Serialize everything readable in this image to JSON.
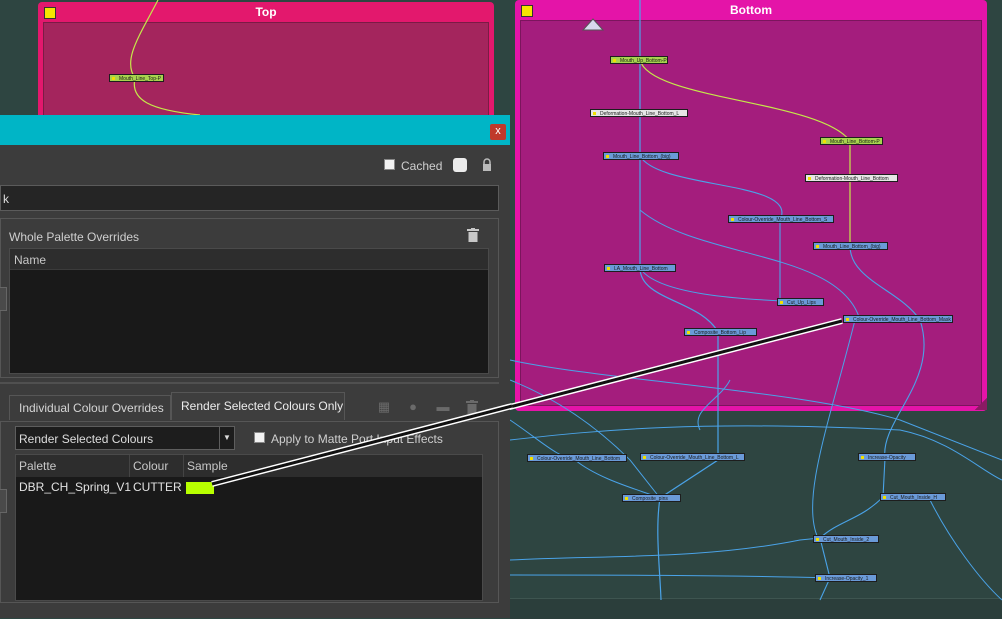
{
  "node_view": {
    "backdrops": [
      {
        "title": "Top",
        "color": "#e3186d",
        "inner": "#a4255d"
      },
      {
        "title": "Bottom",
        "color": "#e414a8",
        "inner": "#a41d7d"
      }
    ],
    "nodes": [
      {
        "label": "Mouth_Line_Top-P",
        "kind": "green"
      },
      {
        "label": "Mouth_Up_Bottom-P",
        "kind": "green"
      },
      {
        "label": "Deformation-Mouth_Line_Bottom_L",
        "kind": "white"
      },
      {
        "label": "Mouth_Line_Bottom_(big)",
        "kind": "blue"
      },
      {
        "label": "Mouth_Line_Bottom-P",
        "kind": "green"
      },
      {
        "label": "Deformation-Mouth_Line_Bottom",
        "kind": "white"
      },
      {
        "label": "Colour-Override_Mouth_Line_Bottom_S",
        "kind": "blue"
      },
      {
        "label": "Mouth_Line_Bottom_(big)",
        "kind": "blue"
      },
      {
        "label": "LA_Mouth_Line_Bottom",
        "kind": "blue"
      },
      {
        "label": "Cut_Up_Lips",
        "kind": "blue"
      },
      {
        "label": "Colour-Override_Mouth_Line_Bottom_Mask",
        "kind": "blue"
      },
      {
        "label": "Composite_Bottom_Lip",
        "kind": "blue"
      },
      {
        "label": "Colour-Override_Mouth_Line_Bottom",
        "kind": "blue"
      },
      {
        "label": "Colour-Override_Mouth_Line_Bottom_L",
        "kind": "blue"
      },
      {
        "label": "Increase-Opacity",
        "kind": "blue"
      },
      {
        "label": "Composite_pins",
        "kind": "blue"
      },
      {
        "label": "Cut_Mouth_Inside_H",
        "kind": "blue"
      },
      {
        "label": "Cut_Mouth_Inside_2",
        "kind": "blue"
      },
      {
        "label": "Increase-Opacity_1",
        "kind": "blue"
      }
    ]
  },
  "panel": {
    "close_glyph": "x",
    "cached_label": "Cached",
    "name_value": "k",
    "whole_palette_title": "Whole Palette Overrides",
    "wpo_column": "Name",
    "tabs": [
      {
        "label": "Individual Colour Overrides",
        "active": false
      },
      {
        "label": "Render Selected Colours Only",
        "active": true
      }
    ],
    "mode_select": {
      "value": "Render Selected Colours",
      "arrow": "▼"
    },
    "apply_matte_label": "Apply to Matte Port Input Effects",
    "table_headers": [
      "Palette",
      "Colour",
      "Sample"
    ],
    "rows": [
      {
        "palette": "DBR_CH_Spring_V1",
        "colour": "CUTTER",
        "sample": "#b8ff00"
      }
    ]
  }
}
